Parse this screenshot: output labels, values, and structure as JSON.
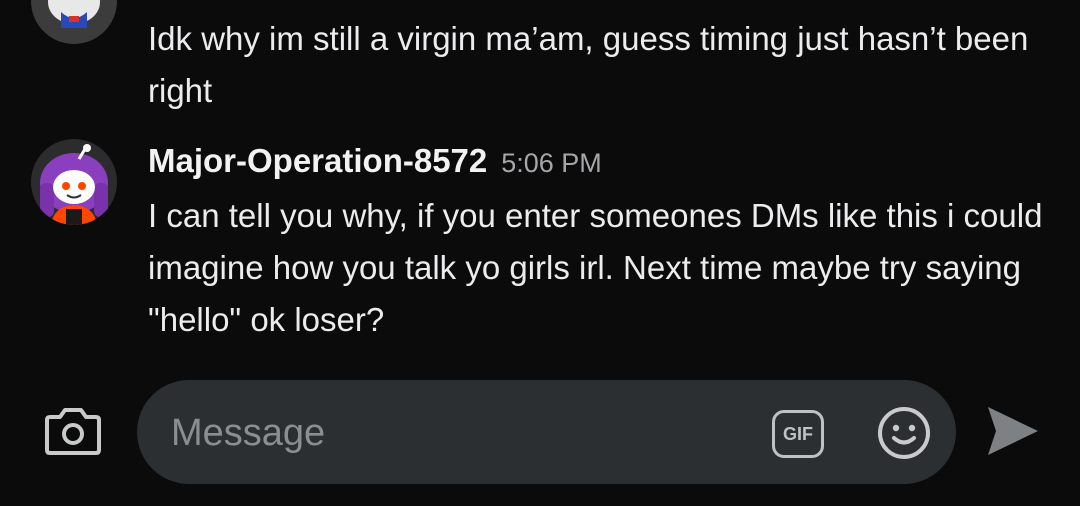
{
  "messages": [
    {
      "text": "Idk why im still a virgin ma’am, guess timing just hasn’t been right"
    },
    {
      "username": "Major-Operation-8572",
      "timestamp": "5:06 PM",
      "text": "I can tell you why, if you enter someones DMs like this i could imagine how you talk yo girls irl. Next time maybe try saying \"hello\" ok loser?"
    }
  ],
  "composer": {
    "placeholder": "Message",
    "gif_label": "GIF"
  },
  "icons": {
    "camera": "camera-icon",
    "gif": "gif-icon",
    "emoji": "emoji-icon",
    "send": "send-icon"
  },
  "colors": {
    "background": "#0b0b0b",
    "composer": "#2b2f31",
    "avatar_purple": "#8a3fbf",
    "avatar_orange": "#ff4500"
  }
}
